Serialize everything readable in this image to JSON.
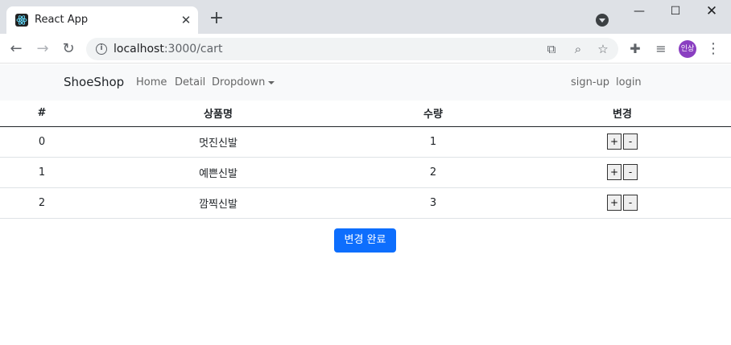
{
  "browser": {
    "tab_title": "React App",
    "url_host": "localhost",
    "url_rest": ":3000/cart",
    "avatar_text": "인상"
  },
  "navbar": {
    "brand": "ShoeShop",
    "links": [
      "Home",
      "Detail",
      "Dropdown"
    ],
    "right_links": [
      "sign-up",
      "login"
    ]
  },
  "table": {
    "headers": [
      "#",
      "상품명",
      "수량",
      "변경"
    ],
    "rows": [
      {
        "id": "0",
        "name": "멋진신발",
        "qty": "1"
      },
      {
        "id": "1",
        "name": "예쁜신발",
        "qty": "2"
      },
      {
        "id": "2",
        "name": "깜찍신발",
        "qty": "3"
      }
    ],
    "plus_label": "+",
    "minus_label": "-"
  },
  "done_button": "변경 완료",
  "colors": {
    "primary": "#0d6efd",
    "navbar_bg": "#f8f9fa",
    "avatar": "#8a3fc1"
  }
}
